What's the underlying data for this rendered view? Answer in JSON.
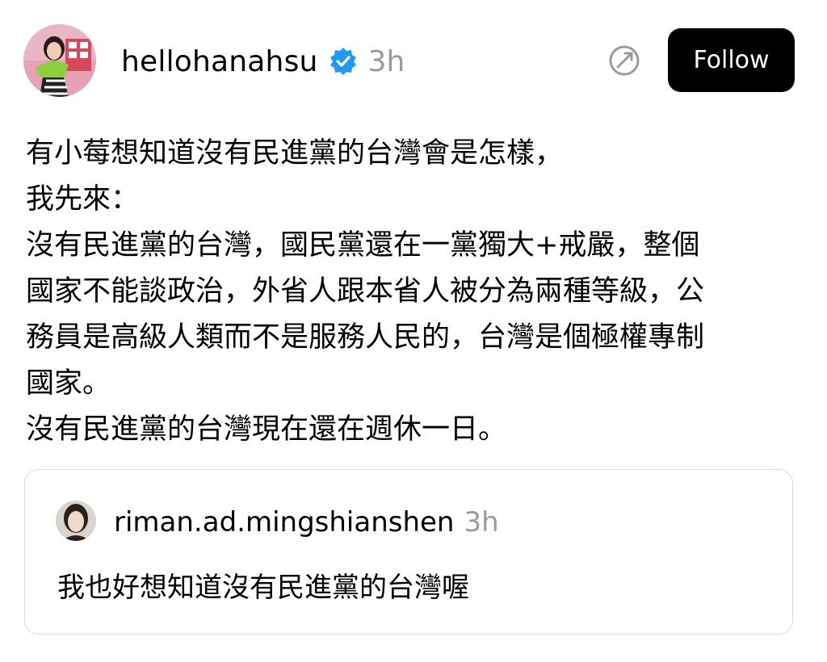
{
  "post": {
    "author": {
      "username": "hellohanahsu",
      "verified": true,
      "time": "3h",
      "avatar_icon": "profile-photo"
    },
    "follow_label": "Follow",
    "repost_icon": "repost-icon",
    "lines": [
      "有小莓想知道沒有民進黨的台灣會是怎樣，",
      "我先來：",
      "沒有民進黨的台灣，國民黨還在一黨獨大+戒嚴，整個",
      "國家不能談政治，外省人跟本省人被分為兩種等級，公",
      "務員是高級人類而不是服務人民的，台灣是個極權專制",
      "國家。",
      "沒有民進黨的台灣現在還在週休一日。"
    ]
  },
  "quoted_post": {
    "author": {
      "username": "riman.ad.mingshianshen",
      "time": "3h"
    },
    "text": "我也好想知道沒有民進黨的台灣喔"
  },
  "colors": {
    "verified_badge": "#1d9bf0",
    "timestamp": "#9a9a9a",
    "follow_bg": "#000000",
    "card_border": "#d9d9d9"
  }
}
